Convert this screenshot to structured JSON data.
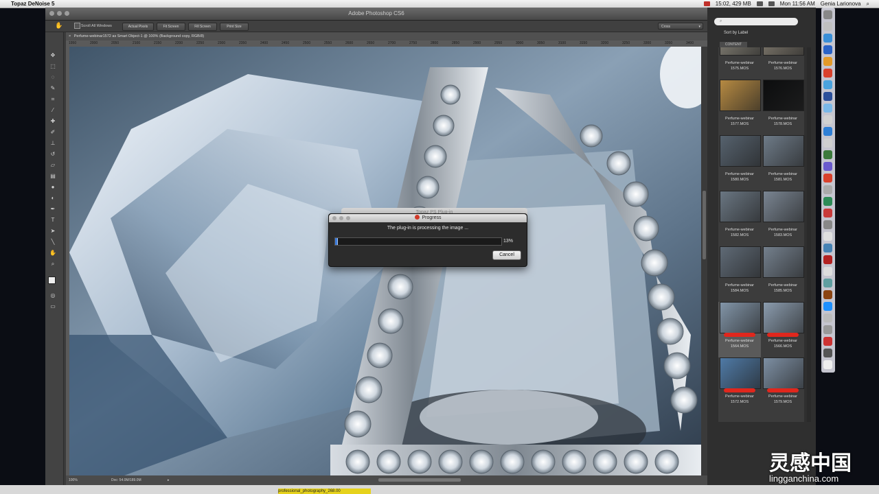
{
  "menubar": {
    "app": "Topaz DeNoise 5",
    "status": "15:02, 429 MB",
    "clock": "Mon 11:56 AM",
    "user": "Genia Larionova"
  },
  "photoshop": {
    "title": "Adobe Photoshop CS6",
    "options": {
      "scroll_all": "Scroll All Windows",
      "buttons": [
        "Actual Pixels",
        "Fit Screen",
        "Fill Screen",
        "Print Size"
      ],
      "workspace": "Cross"
    },
    "doc_tab": "Perfume-webinar1572 as Smart Object-1 @ 100% (Background copy, RGB/8)",
    "ruler_ticks": [
      "1950",
      "2000",
      "2050",
      "2100",
      "2150",
      "2200",
      "2250",
      "2300",
      "2350",
      "2400",
      "2450",
      "2500",
      "2550",
      "2600",
      "2650",
      "2700",
      "2750",
      "2800",
      "2850",
      "2900",
      "2950",
      "3000",
      "3050",
      "3100",
      "3150",
      "3200",
      "3250",
      "3300",
      "3350",
      "3400"
    ],
    "status": {
      "zoom": "100%",
      "doc": "Doc: 54.0M/189.0M"
    }
  },
  "dialog": {
    "back_title": "Topaz PS Plug-in",
    "title": "Progress",
    "message": "The plug-in is processing the image ...",
    "progress_percent": 13,
    "progress_label": "13%",
    "cancel_label": "Cancel"
  },
  "bridge": {
    "search_placeholder": "",
    "sort_label": "Sort by Label",
    "content_tab": "CONTENT",
    "thumbnails": [
      {
        "line1": "Perfume-webinar",
        "line2": "1575.MOS",
        "color": "#8e8a7e",
        "bar": false
      },
      {
        "line1": "Perfume-webinar",
        "line2": "1576.MOS",
        "color": "#8c8578",
        "bar": false
      },
      {
        "line1": "Perfume-webinar",
        "line2": "1577.MOS",
        "color": "#b68a42",
        "bar": false
      },
      {
        "line1": "Perfume-webinar",
        "line2": "1578.MOS",
        "color": "#0c0d0e",
        "bar": false
      },
      {
        "line1": "Perfume-webinar",
        "line2": "1580.MOS",
        "color": "#56626e",
        "bar": false
      },
      {
        "line1": "Perfume-webinar",
        "line2": "1581.MOS",
        "color": "#6e7b88",
        "bar": false
      },
      {
        "line1": "Perfume-webinar",
        "line2": "1582.MOS",
        "color": "#6a7682",
        "bar": false
      },
      {
        "line1": "Perfume-webinar",
        "line2": "1583.MOS",
        "color": "#7a8592",
        "bar": false
      },
      {
        "line1": "Perfume-webinar",
        "line2": "1584.MOS",
        "color": "#5f6a76",
        "bar": false
      },
      {
        "line1": "Perfume-webinar",
        "line2": "1585.MOS",
        "color": "#74808d",
        "bar": false
      },
      {
        "line1": "Perfume-webinar",
        "line2": "1564.MOS",
        "color": "#8295a8",
        "bar": true
      },
      {
        "line1": "Perfume-webinar",
        "line2": "1566.MOS",
        "color": "#8b9cae",
        "bar": true
      },
      {
        "line1": "Perfume-webinar",
        "line2": "1572.MOS",
        "color": "#4f7aa6",
        "bar": true
      },
      {
        "line1": "Perfume-webinar",
        "line2": "1579.MOS",
        "color": "#7d8fa3",
        "bar": true
      }
    ]
  },
  "watermark": {
    "text": "灵感中国",
    "url": "lingganchina.com"
  },
  "desktop": {
    "note": "professional_photography_268.00"
  }
}
